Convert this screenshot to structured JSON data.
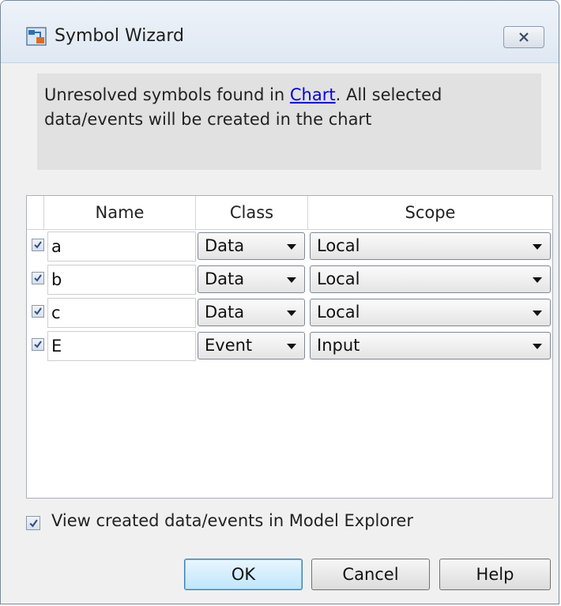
{
  "window": {
    "title": "Symbol Wizard",
    "close_icon": "close-icon",
    "app_icon": "stateflow-icon"
  },
  "info": {
    "text_before": "Unresolved symbols found in ",
    "link_text": "Chart",
    "text_after": ". All selected data/events will be created in the chart"
  },
  "table": {
    "headers": {
      "name": "Name",
      "class": "Class",
      "scope": "Scope"
    },
    "rows": [
      {
        "checked": true,
        "name": "a",
        "class": "Data",
        "scope": "Local"
      },
      {
        "checked": true,
        "name": "b",
        "class": "Data",
        "scope": "Local"
      },
      {
        "checked": true,
        "name": "c",
        "class": "Data",
        "scope": "Local"
      },
      {
        "checked": true,
        "name": "E",
        "class": "Event",
        "scope": "Input"
      }
    ]
  },
  "options": {
    "view_in_explorer_checked": true,
    "view_in_explorer_label": "View created data/events in Model Explorer"
  },
  "buttons": {
    "ok": "OK",
    "cancel": "Cancel",
    "help": "Help"
  },
  "colors": {
    "link": "#0000ee",
    "info_bg": "#e1e1e1",
    "dialog_bg": "#f0f0f0"
  }
}
